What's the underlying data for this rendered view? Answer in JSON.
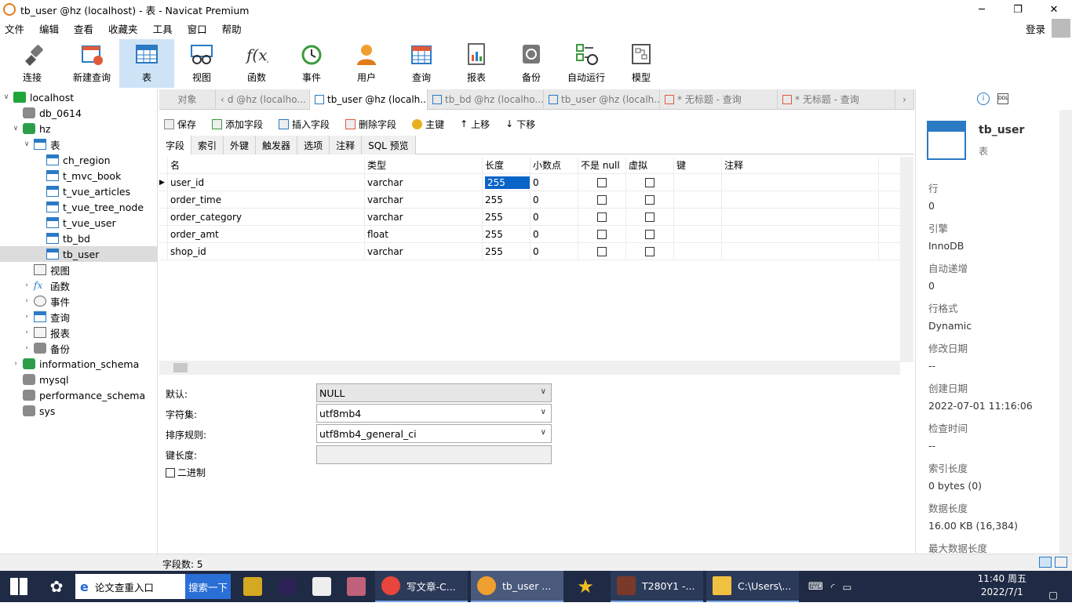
{
  "window": {
    "title": "tb_user @hz (localhost) - 表 - Navicat Premium"
  },
  "menu": [
    "文件",
    "编辑",
    "查看",
    "收藏夹",
    "工具",
    "窗口",
    "帮助"
  ],
  "login": "登录",
  "toolbar": [
    "连接",
    "新建查询",
    "表",
    "视图",
    "函数",
    "事件",
    "用户",
    "查询",
    "报表",
    "备份",
    "自动运行",
    "模型"
  ],
  "tree": {
    "host": "localhost",
    "db1": "db_0614",
    "db2": "hz",
    "tables_folder": "表",
    "tables": [
      "ch_region",
      "t_mvc_book",
      "t_vue_articles",
      "t_vue_tree_node",
      "t_vue_user",
      "tb_bd",
      "tb_user"
    ],
    "folders": [
      "视图",
      "函数",
      "事件",
      "查询",
      "报表",
      "备份"
    ],
    "dbs": [
      "information_schema",
      "mysql",
      "performance_schema",
      "sys"
    ]
  },
  "tabs": [
    "对象",
    "d @hz (localho...",
    "tb_user @hz (localh...",
    "tb_bd @hz (localho...",
    "tb_user @hz (localh...",
    "* 无标题 - 查询",
    "* 无标题 - 查询"
  ],
  "subtoolbar": [
    "保存",
    "添加字段",
    "插入字段",
    "删除字段",
    "主键",
    "上移",
    "下移"
  ],
  "innertabs": [
    "字段",
    "索引",
    "外键",
    "触发器",
    "选项",
    "注释",
    "SQL 预览"
  ],
  "grid": {
    "headers": [
      "名",
      "类型",
      "长度",
      "小数点",
      "不是 null",
      "虚拟",
      "键",
      "注释"
    ],
    "rows": [
      {
        "name": "user_id",
        "type": "varchar",
        "len": "255",
        "dec": "0"
      },
      {
        "name": "order_time",
        "type": "varchar",
        "len": "255",
        "dec": "0"
      },
      {
        "name": "order_category",
        "type": "varchar",
        "len": "255",
        "dec": "0"
      },
      {
        "name": "order_amt",
        "type": "float",
        "len": "255",
        "dec": "0"
      },
      {
        "name": "shop_id",
        "type": "varchar",
        "len": "255",
        "dec": "0"
      }
    ]
  },
  "props": {
    "default_label": "默认:",
    "default_value": "NULL",
    "charset_label": "字符集:",
    "charset_value": "utf8mb4",
    "collation_label": "排序规则:",
    "collation_value": "utf8mb4_general_ci",
    "keylen_label": "键长度:",
    "binary_label": "二进制"
  },
  "info": {
    "title": "tb_user",
    "subtitle": "表",
    "items": [
      {
        "label": "行",
        "value": "0"
      },
      {
        "label": "引擎",
        "value": "InnoDB"
      },
      {
        "label": "自动递增",
        "value": "0"
      },
      {
        "label": "行格式",
        "value": "Dynamic"
      },
      {
        "label": "修改日期",
        "value": "--"
      },
      {
        "label": "创建日期",
        "value": "2022-07-01 11:16:06"
      },
      {
        "label": "检查时间",
        "value": "--"
      },
      {
        "label": "索引长度",
        "value": "0 bytes (0)"
      },
      {
        "label": "数据长度",
        "value": "16.00 KB (16,384)"
      },
      {
        "label": "最大数据长度",
        "value": ""
      }
    ]
  },
  "status": "字段数: 5",
  "taskbar": {
    "search_text": "论文查重入口",
    "search_btn": "搜索一下",
    "apps": [
      "写文章-C...",
      "tb_user ...",
      "T280Y1 -...",
      "C:\\Users\\..."
    ],
    "time": "11:40 周五",
    "date": "2022/7/1"
  }
}
